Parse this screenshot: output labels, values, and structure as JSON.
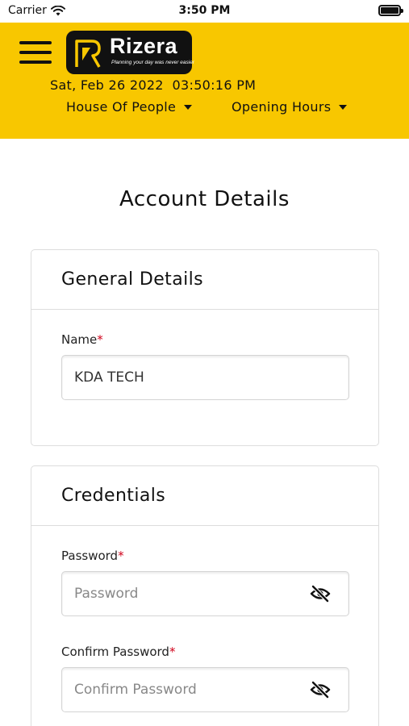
{
  "status_bar": {
    "carrier": "Carrier",
    "time": "3:50 PM"
  },
  "header": {
    "brand_name": "Rizera",
    "brand_tagline": "Planning your day was never easier",
    "datetime": "Sat, Feb 26 2022  03:50:16 PM",
    "location_dropdown": "House Of People",
    "hours_dropdown": "Opening Hours",
    "background_color": "#f8c700"
  },
  "page": {
    "title": "Account Details"
  },
  "general_details": {
    "heading": "General Details",
    "name_label": "Name",
    "required_mark": "*",
    "name_value": "KDA TECH"
  },
  "credentials": {
    "heading": "Credentials",
    "password_label": "Password",
    "password_placeholder": "Password",
    "confirm_label": "Confirm Password",
    "confirm_placeholder": "Confirm Password",
    "required_mark": "*",
    "toggle_icon": "eye-slash-icon"
  }
}
